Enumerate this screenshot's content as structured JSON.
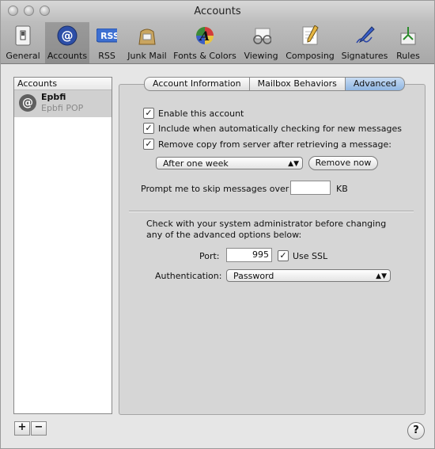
{
  "window": {
    "title": "Accounts"
  },
  "toolbar": {
    "items": [
      {
        "label": "General",
        "icon": "general-switch-icon"
      },
      {
        "label": "Accounts",
        "icon": "at-sign-icon"
      },
      {
        "label": "RSS",
        "icon": "rss-icon"
      },
      {
        "label": "Junk Mail",
        "icon": "junk-mail-bag-icon"
      },
      {
        "label": "Fonts & Colors",
        "icon": "fonts-colors-icon"
      },
      {
        "label": "Viewing",
        "icon": "viewing-glasses-icon"
      },
      {
        "label": "Composing",
        "icon": "composing-pencil-icon"
      },
      {
        "label": "Signatures",
        "icon": "signatures-pen-icon"
      },
      {
        "label": "Rules",
        "icon": "rules-icon"
      }
    ],
    "selected": "Accounts"
  },
  "sidebar": {
    "header": "Accounts",
    "account": {
      "name": "Epbfi",
      "type": "Epbfi POP"
    },
    "add_label": "+",
    "remove_label": "−"
  },
  "tabs": [
    "Account Information",
    "Mailbox Behaviors",
    "Advanced"
  ],
  "active_tab": "Advanced",
  "advanced": {
    "enable_account": {
      "label": "Enable this account",
      "checked": true
    },
    "include_checking": {
      "label": "Include when automatically checking for new messages",
      "checked": true
    },
    "remove_copy": {
      "label": "Remove copy from server after retrieving a message:",
      "checked": true
    },
    "remove_after": "After one week",
    "remove_now_label": "Remove now",
    "prompt_label": "Prompt me to skip messages over",
    "prompt_value": "",
    "prompt_unit": "KB",
    "admin_note_line1": "Check with your system administrator before changing",
    "admin_note_line2": "any of the advanced options below:",
    "port_label": "Port:",
    "port_value": "995",
    "use_ssl": {
      "label": "Use SSL",
      "checked": true
    },
    "auth_label": "Authentication:",
    "auth_value": "Password"
  },
  "help_label": "?"
}
